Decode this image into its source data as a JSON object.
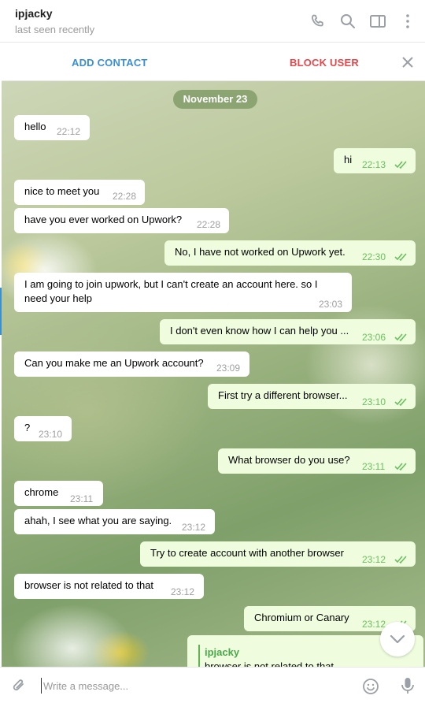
{
  "header": {
    "name": "ipjacky",
    "status": "last seen recently",
    "icons": [
      "phone-icon",
      "search-icon",
      "sidebar-panel-icon",
      "more-vertical-icon"
    ]
  },
  "action_bar": {
    "add_contact": "ADD CONTACT",
    "block_user": "BLOCK USER",
    "close_icon": "close-icon"
  },
  "chat": {
    "date": "November 23",
    "messages": [
      {
        "dir": "in",
        "text": "hello",
        "time": "22:12"
      },
      {
        "dir": "out",
        "text": "hi",
        "time": "22:13",
        "read": true
      },
      {
        "dir": "in",
        "text": "nice to meet you",
        "time": "22:28"
      },
      {
        "dir": "in",
        "text": "have you ever worked on Upwork?",
        "time": "22:28"
      },
      {
        "dir": "out",
        "text": "No, I have not worked on Upwork yet.",
        "time": "22:30",
        "read": true
      },
      {
        "dir": "in",
        "text": "I am going to join upwork, but I can't create an account here. so I need your help",
        "time": "23:03"
      },
      {
        "dir": "out",
        "text": "I don't even know how I can help you ...",
        "time": "23:06",
        "read": true
      },
      {
        "dir": "in",
        "text": "Can you make me an Upwork account?",
        "time": "23:09"
      },
      {
        "dir": "out",
        "text": "First try a different browser...",
        "time": "23:10",
        "read": true
      },
      {
        "dir": "in",
        "text": "?",
        "time": "23:10"
      },
      {
        "dir": "out",
        "text": "What browser do you use?",
        "time": "23:11",
        "read": true
      },
      {
        "dir": "in",
        "text": "chrome",
        "time": "23:11"
      },
      {
        "dir": "in",
        "text": "ahah, I see what you are saying.",
        "time": "23:12"
      },
      {
        "dir": "out",
        "text": "Try to create account with another browser",
        "time": "23:12",
        "read": true
      },
      {
        "dir": "in",
        "text": "browser is not related to that",
        "time": "23:12"
      },
      {
        "dir": "out",
        "text": "Chromium or Canary",
        "time": "23:12",
        "read": true
      }
    ],
    "reply": {
      "name": "ipjacky",
      "text": "browser is not related to that"
    }
  },
  "composer": {
    "placeholder": "Write a message...",
    "icons": [
      "paperclip-icon",
      "emoji-icon",
      "microphone-icon"
    ]
  },
  "colors": {
    "accent": "#3a8ed3",
    "danger": "#e5474b",
    "outgoing_bubble": "#effdde",
    "read_checks": "#6cbf60"
  }
}
